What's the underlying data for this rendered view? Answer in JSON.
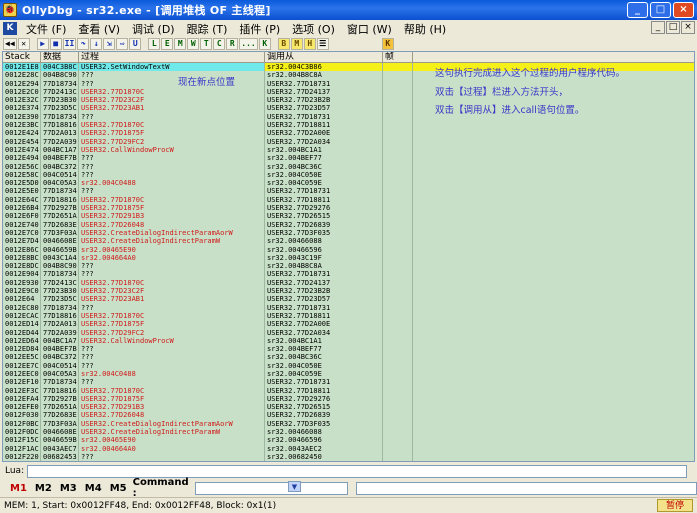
{
  "window": {
    "title": "OllyDbg - sr32.exe - [调用堆栈 OF 主线程]",
    "icon_glyph": "🐞",
    "buttons": [
      "_",
      "□",
      "×"
    ]
  },
  "menubar": {
    "logo": "K",
    "items": [
      "文件 (F)",
      "查看 (V)",
      "调试 (D)",
      "跟踪 (T)",
      "插件 (P)",
      "选项 (O)",
      "窗口 (W)",
      "帮助 (H)"
    ],
    "mdi_buttons": [
      "_",
      "□",
      "×"
    ]
  },
  "toolbar": {
    "buttons": [
      {
        "label": "◀◀",
        "style": ""
      },
      {
        "label": "✕",
        "style": ""
      },
      {
        "label": "▶",
        "style": "blue"
      },
      {
        "label": "■",
        "style": "blue"
      },
      {
        "label": "II",
        "style": "blue"
      },
      {
        "label": "↷",
        "style": "blue"
      },
      {
        "label": "↓",
        "style": "blue"
      },
      {
        "label": "⇲",
        "style": "blue"
      },
      {
        "label": "⇨",
        "style": "blue"
      },
      {
        "label": "U",
        "style": "blue"
      },
      {
        "label": "L",
        "style": "green"
      },
      {
        "label": "E",
        "style": "green"
      },
      {
        "label": "M",
        "style": "green"
      },
      {
        "label": "W",
        "style": "green"
      },
      {
        "label": "T",
        "style": "green"
      },
      {
        "label": "C",
        "style": "green"
      },
      {
        "label": "R",
        "style": "green"
      },
      {
        "label": "...",
        "style": "green"
      },
      {
        "label": "K",
        "style": "green"
      },
      {
        "label": "B",
        "style": "yellow"
      },
      {
        "label": "M",
        "style": "yellow"
      },
      {
        "label": "H",
        "style": "yellow"
      },
      {
        "label": "☰",
        "style": ""
      },
      {
        "label": "K",
        "style": "orange"
      }
    ]
  },
  "columns": [
    "Stack",
    "数据",
    "过程",
    "调用从",
    "帧",
    ""
  ],
  "rows": [
    {
      "stack": "0012E1E8",
      "data": "004C3B8C",
      "proc": "USER32.SetWindowTextW",
      "caller": "sr32.004C3B86",
      "frame": "",
      "selected": true
    },
    {
      "stack": "0012E28C",
      "data": "004B8C90",
      "proc": "???",
      "caller": "sr32.004B8C8A",
      "frame": ""
    },
    {
      "stack": "0012E294",
      "data": "77D18734",
      "proc": "???",
      "caller": "USER32.77D18731",
      "frame": ""
    },
    {
      "stack": "0012E2C0",
      "data": "77D2413C",
      "proc": "USER32.77D1870C",
      "caller": "USER32.77D24137",
      "frame": ""
    },
    {
      "stack": "0012E32C",
      "data": "77D23B30",
      "proc": "USER32.77D23C2F",
      "caller": "USER32.77D23B2B",
      "frame": ""
    },
    {
      "stack": "0012E374",
      "data": "77D23D5C",
      "proc": "USER32.77D23AB1",
      "caller": "USER32.77D23D57",
      "frame": ""
    },
    {
      "stack": "0012E390",
      "data": "77D18734",
      "proc": "???",
      "caller": "USER32.77D18731",
      "frame": ""
    },
    {
      "stack": "0012E3BC",
      "data": "77D18816",
      "proc": "USER32.77D1870C",
      "caller": "USER32.77D18811",
      "frame": ""
    },
    {
      "stack": "0012E424",
      "data": "77D2A013",
      "proc": "USER32.77D1875F",
      "caller": "USER32.77D2A00E",
      "frame": ""
    },
    {
      "stack": "0012E454",
      "data": "77D2A039",
      "proc": "USER32.77D29FC2",
      "caller": "USER32.77D2A034",
      "frame": ""
    },
    {
      "stack": "0012E474",
      "data": "004BC1A7",
      "proc": "USER32.CallWindowProcW",
      "caller": "sr32.004BC1A1",
      "frame": ""
    },
    {
      "stack": "0012E494",
      "data": "004BEF7B",
      "proc": "???",
      "caller": "sr32.004BEF77",
      "frame": ""
    },
    {
      "stack": "0012E56C",
      "data": "004BC372",
      "proc": "???",
      "caller": "sr32.004BC36C",
      "frame": ""
    },
    {
      "stack": "0012E58C",
      "data": "004C0514",
      "proc": "???",
      "caller": "sr32.004C050E",
      "frame": ""
    },
    {
      "stack": "0012E5D0",
      "data": "004C05A3",
      "proc": "sr32.004C0488",
      "caller": "sr32.004C059E",
      "frame": ""
    },
    {
      "stack": "0012E5E0",
      "data": "77D18734",
      "proc": "???",
      "caller": "USER32.77D18731",
      "frame": ""
    },
    {
      "stack": "0012E64C",
      "data": "77D18816",
      "proc": "USER32.77D1870C",
      "caller": "USER32.77D18811",
      "frame": ""
    },
    {
      "stack": "0012E6B4",
      "data": "77D2927B",
      "proc": "USER32.77D1875F",
      "caller": "USER32.77D29276",
      "frame": ""
    },
    {
      "stack": "0012E6F0",
      "data": "77D2651A",
      "proc": "USER32.77D291B3",
      "caller": "USER32.77D26515",
      "frame": ""
    },
    {
      "stack": "0012E740",
      "data": "77D2683E",
      "proc": "USER32.77D26048",
      "caller": "USER32.77D26839",
      "frame": ""
    },
    {
      "stack": "0012E7C0",
      "data": "77D3F03A",
      "proc": "USER32.CreateDialogIndirectParamAorW",
      "caller": "USER32.77D3F035",
      "frame": ""
    },
    {
      "stack": "0012E7D4",
      "data": "0046608E",
      "proc": "USER32.CreateDialogIndirectParamW",
      "caller": "sr32.00466088",
      "frame": ""
    },
    {
      "stack": "0012E86C",
      "data": "0046659B",
      "proc": "sr32.00465E90",
      "caller": "sr32.00466596",
      "frame": ""
    },
    {
      "stack": "0012E8BC",
      "data": "0043C1A4",
      "proc": "sr32.004664A0",
      "caller": "sr32.0043C19F",
      "frame": ""
    },
    {
      "stack": "0012E8DC",
      "data": "004B8C90",
      "proc": "???",
      "caller": "sr32.004B8C8A",
      "frame": ""
    },
    {
      "stack": "0012E904",
      "data": "77D18734",
      "proc": "???",
      "caller": "USER32.77D18731",
      "frame": ""
    },
    {
      "stack": "0012E930",
      "data": "77D2413C",
      "proc": "USER32.77D1870C",
      "caller": "USER32.77D24137",
      "frame": ""
    },
    {
      "stack": "0012E9C0",
      "data": "77D23B30",
      "proc": "USER32.77D23C2F",
      "caller": "USER32.77D23B2B",
      "frame": ""
    },
    {
      "stack": "0012E64",
      "data": "77D23D5C",
      "proc": "USER32.77D23AB1",
      "caller": "USER32.77D23D57",
      "frame": ""
    },
    {
      "stack": "0012EC80",
      "data": "77D18734",
      "proc": "???",
      "caller": "USER32.77D18731",
      "frame": ""
    },
    {
      "stack": "0012ECAC",
      "data": "77D18816",
      "proc": "USER32.77D1870C",
      "caller": "USER32.77D18811",
      "frame": ""
    },
    {
      "stack": "0012ED14",
      "data": "77D2A013",
      "proc": "USER32.77D1875F",
      "caller": "USER32.77D2A00E",
      "frame": ""
    },
    {
      "stack": "0012ED44",
      "data": "77D2A039",
      "proc": "USER32.77D29FC2",
      "caller": "USER32.77D2A034",
      "frame": ""
    },
    {
      "stack": "0012ED64",
      "data": "004BC1A7",
      "proc": "USER32.CallWindowProcW",
      "caller": "sr32.004BC1A1",
      "frame": ""
    },
    {
      "stack": "0012ED84",
      "data": "004BEF7B",
      "proc": "???",
      "caller": "sr32.004BEF77",
      "frame": ""
    },
    {
      "stack": "0012EE5C",
      "data": "004BC372",
      "proc": "???",
      "caller": "sr32.004BC36C",
      "frame": ""
    },
    {
      "stack": "0012EE7C",
      "data": "004C0514",
      "proc": "???",
      "caller": "sr32.004C050E",
      "frame": ""
    },
    {
      "stack": "0012EEC0",
      "data": "004C05A3",
      "proc": "sr32.004C0488",
      "caller": "sr32.004C059E",
      "frame": ""
    },
    {
      "stack": "0012EF10",
      "data": "77D18734",
      "proc": "???",
      "caller": "USER32.77D18731",
      "frame": ""
    },
    {
      "stack": "0012EF3C",
      "data": "77D18816",
      "proc": "USER32.77D1870C",
      "caller": "USER32.77D18811",
      "frame": ""
    },
    {
      "stack": "0012EFA4",
      "data": "77D2927B",
      "proc": "USER32.77D1875F",
      "caller": "USER32.77D29276",
      "frame": ""
    },
    {
      "stack": "0012EFE0",
      "data": "77D2651A",
      "proc": "USER32.77D291B3",
      "caller": "USER32.77D26515",
      "frame": ""
    },
    {
      "stack": "0012F030",
      "data": "77D2683E",
      "proc": "USER32.77D26048",
      "caller": "USER32.77D26839",
      "frame": ""
    },
    {
      "stack": "0012F0BC",
      "data": "77D3F03A",
      "proc": "USER32.CreateDialogIndirectParamAorW",
      "caller": "USER32.77D3F035",
      "frame": ""
    },
    {
      "stack": "0012F0DC",
      "data": "0046608E",
      "proc": "USER32.CreateDialogIndirectParamW",
      "caller": "sr32.00466088",
      "frame": ""
    },
    {
      "stack": "0012F15C",
      "data": "0046659B",
      "proc": "sr32.00465E90",
      "caller": "sr32.00466596",
      "frame": ""
    },
    {
      "stack": "0012F1AC",
      "data": "0043AEC7",
      "proc": "sr32.004664A0",
      "caller": "sr32.0043AEC2",
      "frame": ""
    },
    {
      "stack": "0012F220",
      "data": "00682453",
      "proc": "???",
      "caller": "sr32.00682450",
      "frame": ""
    }
  ],
  "annotations": {
    "breakpoint_note": "现在新点位置",
    "note_line1": "这句执行完成进入这个过程的用户程序代码。",
    "note_line2": "双击【过程】栏进入方法开头，",
    "note_line3": "双击【调用从】进入call语句位置。"
  },
  "lua": {
    "label": "Lua:",
    "value": ""
  },
  "command_bar": {
    "buttons": [
      "M1",
      "M2",
      "M3",
      "M4",
      "M5"
    ],
    "command_label": "Command :",
    "command_value": "",
    "result_value": ""
  },
  "statusbar": {
    "text": "MEM: 1, Start: 0x0012FF48, End: 0x0012FF48, Block: 0x1(1)",
    "state": "暂停"
  },
  "colors": {
    "annotation": "#3b33c9",
    "red_proc": "#d11a1a",
    "selected_left": "#6fe9e9",
    "selected_right": "#f5f018",
    "panel_bg": "#c7e0c7"
  }
}
